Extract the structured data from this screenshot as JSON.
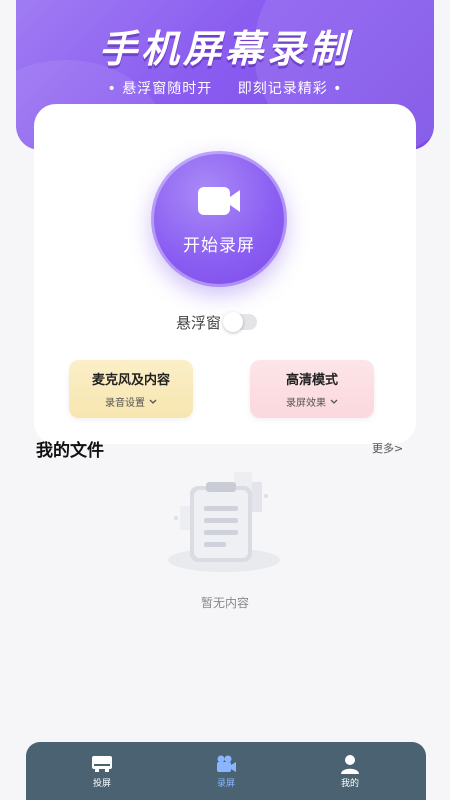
{
  "header": {
    "title": "手机屏幕录制",
    "subtitle_left": "悬浮窗随时开",
    "subtitle_right": "即刻记录精彩",
    "subtitle_dot": "•"
  },
  "record": {
    "label": "开始录屏",
    "icon": "video-camera-icon"
  },
  "floating_window": {
    "label": "悬浮窗",
    "enabled": false
  },
  "features": [
    {
      "title": "麦克风及内容",
      "sub": "录音设置"
    },
    {
      "title": "高清模式",
      "sub": "录屏效果"
    }
  ],
  "files": {
    "title": "我的文件",
    "more": "更多>",
    "empty": "暂无内容"
  },
  "nav": {
    "items": [
      {
        "label": "投屏",
        "icon": "screen-cast-icon",
        "active": false
      },
      {
        "label": "录屏",
        "icon": "video-camera-icon",
        "active": true
      },
      {
        "label": "我的",
        "icon": "user-icon",
        "active": false
      }
    ]
  },
  "colors": {
    "accent": "#8b5ff2",
    "nav_bg": "#4a6272",
    "nav_active": "#8ab6ff",
    "mic_card": "#f7e6b0",
    "hd_card": "#fbd8dd"
  }
}
